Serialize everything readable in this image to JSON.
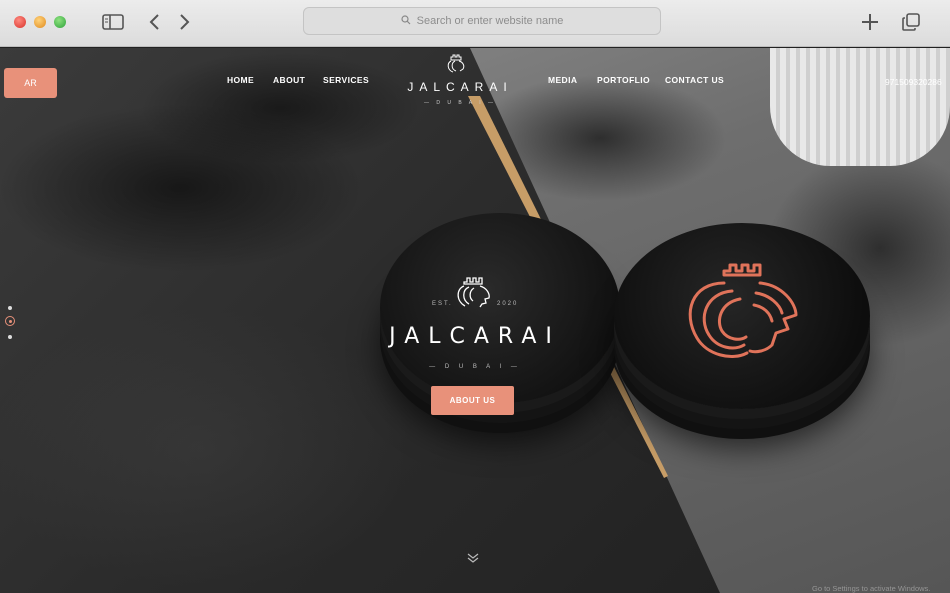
{
  "browser": {
    "address_placeholder": "Search or enter website name",
    "icons": [
      "sidebar-icon",
      "back-icon",
      "forward-icon",
      "search-icon",
      "new-tab-icon",
      "tabs-overview-icon"
    ]
  },
  "site": {
    "lang_button": "AR",
    "nav_left": [
      "HOME",
      "ABOUT",
      "SERVICES"
    ],
    "nav_right": [
      "MEDIA",
      "PORTOFLIO",
      "CONTACT US"
    ],
    "logo_name": "JALCARAI",
    "logo_sub": "— D U B A I —",
    "phone": "971509320286"
  },
  "hero": {
    "est_left": "EST.",
    "est_right": "2020",
    "brand_name": "JALCARAI",
    "brand_sub": "— D U B A I —",
    "cta": "ABOUT US"
  },
  "overlay": {
    "activate_windows": "Go to Settings to activate Windows."
  },
  "colors": {
    "accent": "#e8917a",
    "gold": "#c79d67"
  }
}
